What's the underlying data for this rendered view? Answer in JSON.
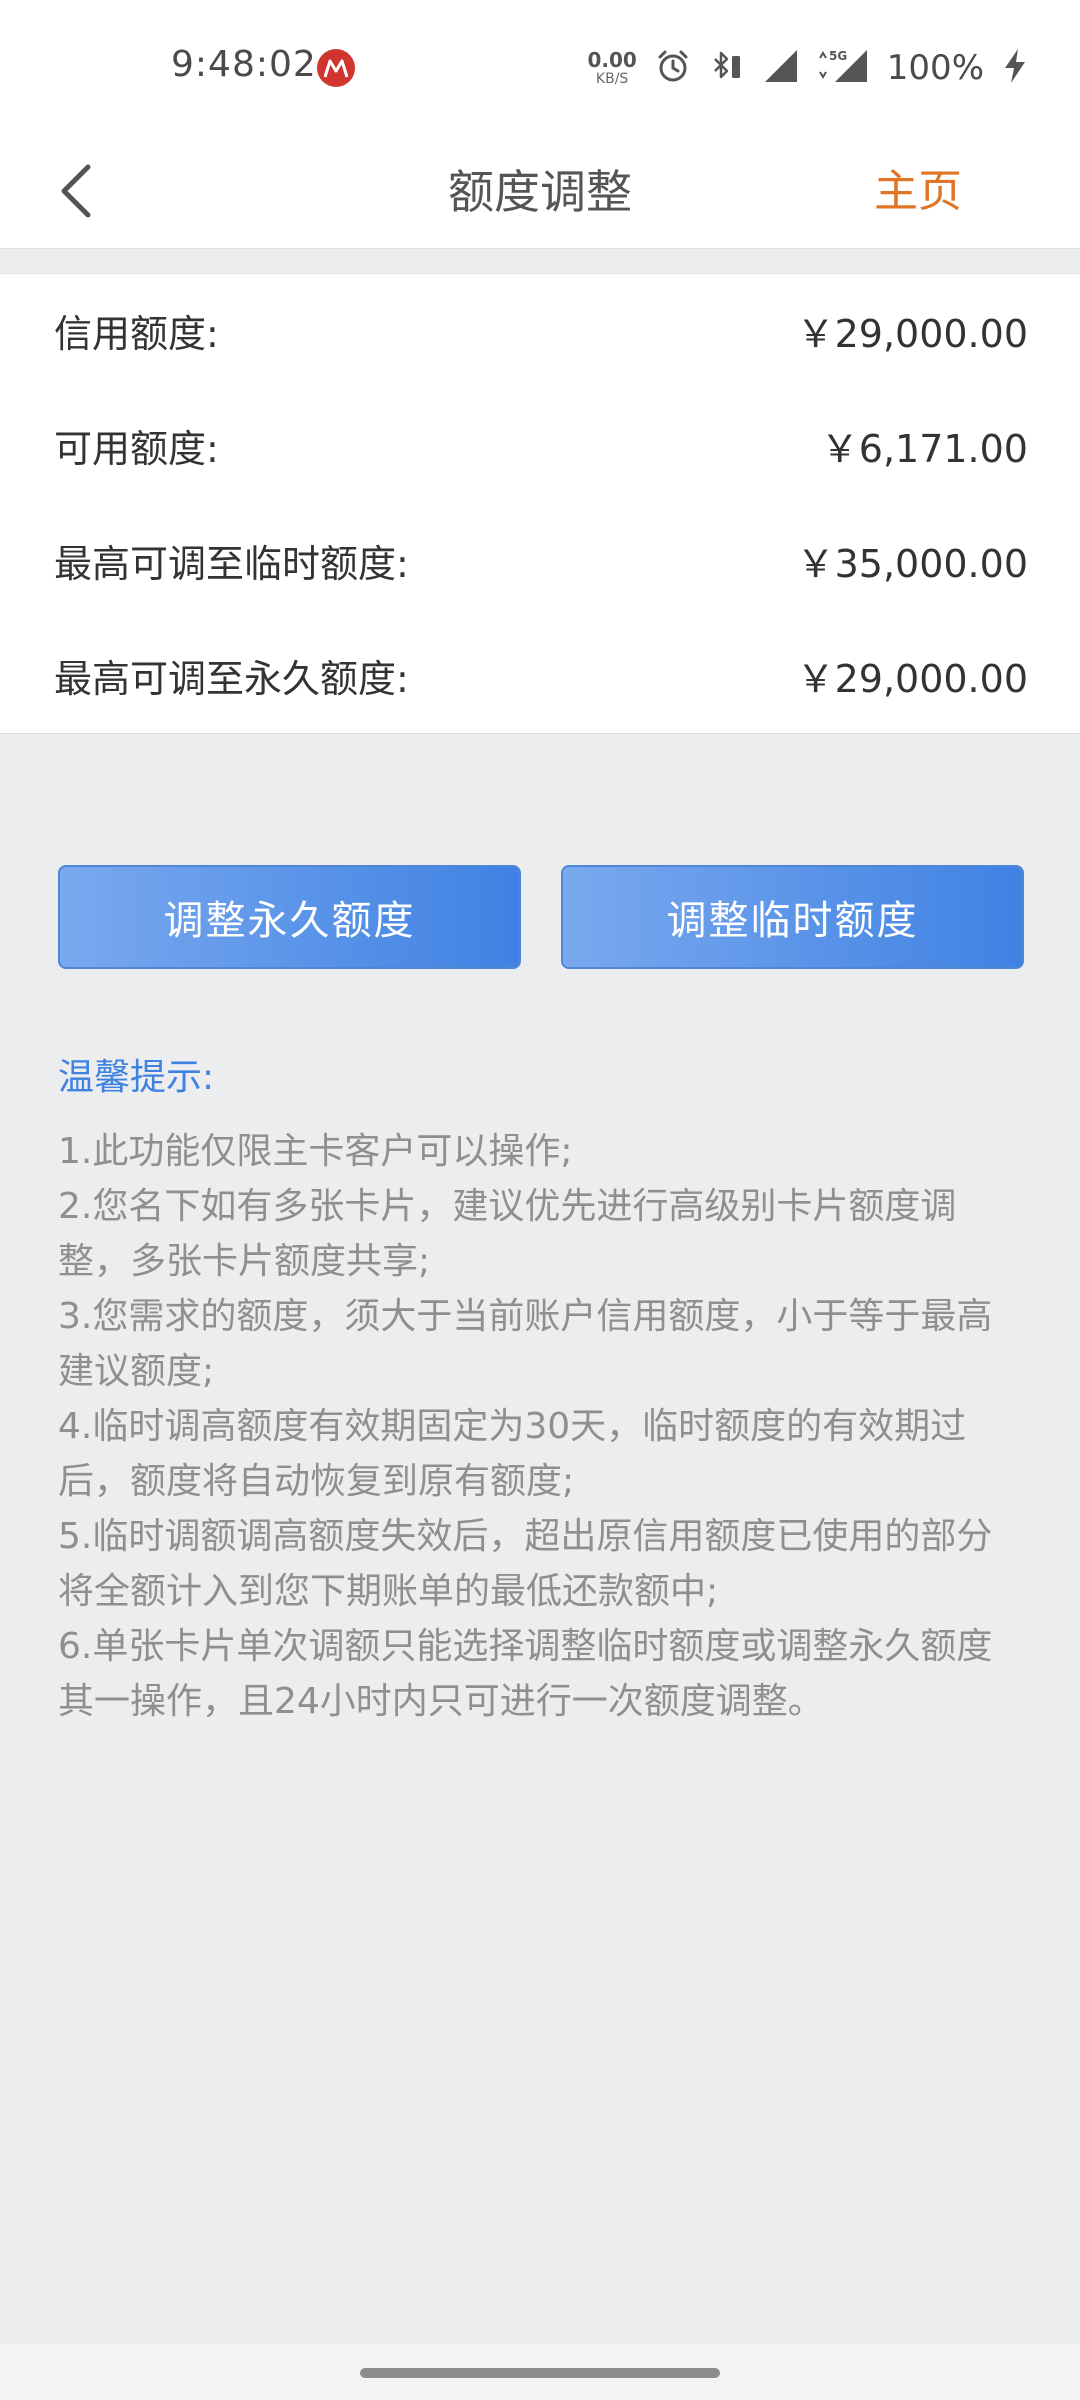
{
  "status_bar": {
    "time": "9:48:02",
    "logo_icon": "bank-logo-icon",
    "net_speed_value": "0.00",
    "net_speed_unit": "KB/S",
    "battery_percent": "100%"
  },
  "nav": {
    "title": "额度调整",
    "home_label": "主页"
  },
  "limits": [
    {
      "label": "信用额度:",
      "value": "￥29,000.00"
    },
    {
      "label": "可用额度:",
      "value": "￥6,171.00"
    },
    {
      "label": "最高可调至临时额度:",
      "value": "￥35,000.00"
    },
    {
      "label": "最高可调至永久额度:",
      "value": "￥29,000.00"
    }
  ],
  "buttons": {
    "permanent": "调整永久额度",
    "temporary": "调整临时额度"
  },
  "tips": {
    "title": "温馨提示:",
    "lines": [
      "1.此功能仅限主卡客户可以操作;",
      "2.您名下如有多张卡片，建议优先进行高级别卡片额度调",
      "整，多张卡片额度共享;",
      "3.您需求的额度，须大于当前账户信用额度，小于等于最高",
      "建议额度;",
      "4.临时调高额度有效期固定为30天，临时额度的有效期过",
      "后，额度将自动恢复到原有额度;",
      "5.临时调额调高额度失效后，超出原信用额度已使用的部分",
      "将全额计入到您下期账单的最低还款额中;",
      "6.单张卡片单次调额只能选择调整临时额度或调整永久额度",
      "其一操作，且24小时内只可进行一次额度调整。"
    ]
  },
  "colors": {
    "accent_orange": "#e07427",
    "accent_blue": "#3f82e3",
    "tip_text": "#8f8f8f"
  }
}
